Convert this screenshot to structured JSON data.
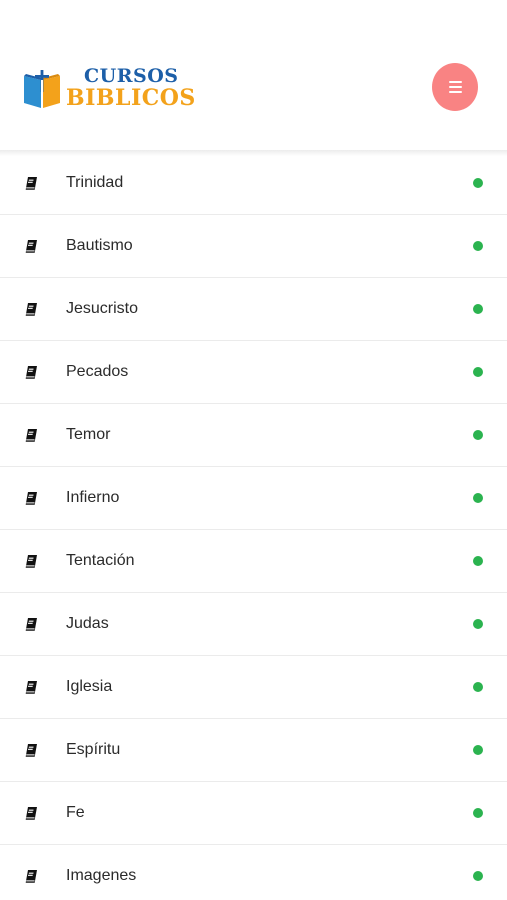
{
  "header": {
    "logo": {
      "line1": "CURSOS",
      "line2": "BIBLICOS",
      "colors": {
        "line1": "#1d5fa8",
        "line2": "#f3a21b"
      }
    },
    "menu_button": {
      "icon": "hamburger-icon",
      "color": "#f98383"
    }
  },
  "courses": {
    "item_icon": "book-icon",
    "status_color": "#2bb34f",
    "items": [
      {
        "label": "Trinidad"
      },
      {
        "label": "Bautismo"
      },
      {
        "label": "Jesucristo"
      },
      {
        "label": "Pecados"
      },
      {
        "label": "Temor"
      },
      {
        "label": "Infierno"
      },
      {
        "label": "Tentación"
      },
      {
        "label": "Judas"
      },
      {
        "label": "Iglesia"
      },
      {
        "label": "Espíritu"
      },
      {
        "label": "Fe"
      },
      {
        "label": "Imagenes"
      }
    ]
  }
}
